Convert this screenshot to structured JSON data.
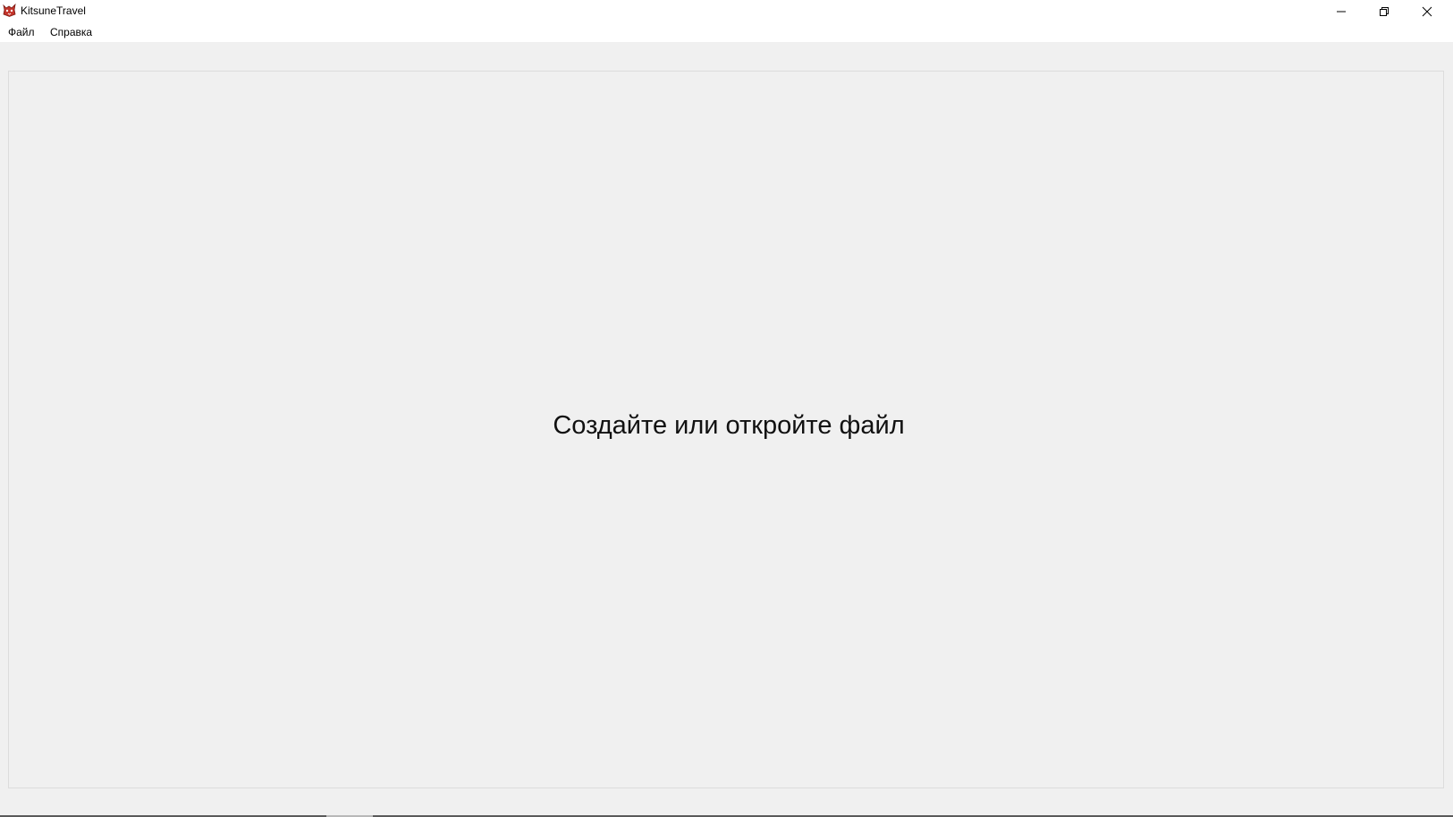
{
  "window": {
    "title": "KitsuneTravel",
    "app_icon": "fox-app-icon",
    "controls": {
      "minimize_icon": "minimize-icon",
      "maximize_icon": "restore-icon",
      "close_icon": "close-icon"
    }
  },
  "menubar": {
    "items": [
      {
        "label": "Файл"
      },
      {
        "label": "Справка"
      }
    ]
  },
  "main": {
    "placeholder": "Создайте или откройте файл"
  }
}
